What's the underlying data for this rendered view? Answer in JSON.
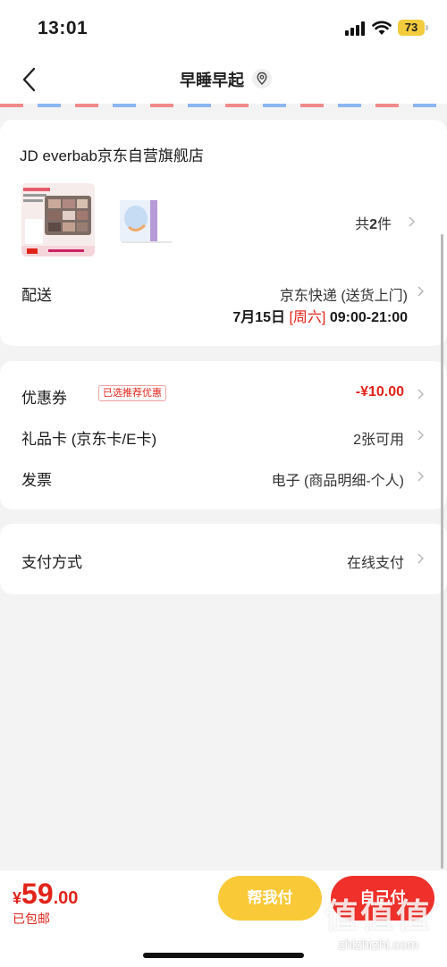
{
  "status_bar": {
    "time": "13:01",
    "battery": "73"
  },
  "nav": {
    "title": "早睡早起"
  },
  "shop": {
    "name": "JD everbab京东自营旗舰店",
    "count_prefix": "共",
    "count": "2",
    "count_suffix": "件"
  },
  "delivery": {
    "label": "配送",
    "method": "京东快递 (送货上门)",
    "date": "7月15日",
    "weekday": "[周六]",
    "time_range": "09:00-21:00"
  },
  "coupon": {
    "label": "优惠券",
    "tag": "已选推荐优惠",
    "value": "-¥10.00"
  },
  "gift_card": {
    "label": "礼品卡 (京东卡/E卡)",
    "value": "2张可用"
  },
  "invoice": {
    "label": "发票",
    "value": "电子 (商品明细-个人)"
  },
  "payment": {
    "label": "支付方式",
    "value": "在线支付"
  },
  "bottom": {
    "currency": "¥",
    "price_int": "59",
    "price_dec": ".00",
    "shipping": "已包邮",
    "help_pay": "帮我付",
    "self_pay": "自己付"
  },
  "watermark": {
    "big": "值值值",
    "small": "zhizhizhi.com"
  },
  "colors": {
    "accent_red": "#e2231a",
    "help_yellow": "#f9c938",
    "self_red": "#f0302a"
  }
}
